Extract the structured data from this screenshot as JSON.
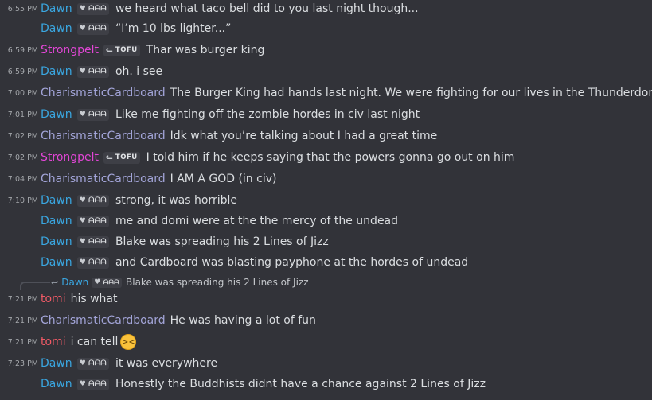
{
  "colors": {
    "dawn": "#3aa6e0",
    "strongpelt": "#e246d6",
    "cardboard": "#a3a5d9",
    "tomi": "#f05a66"
  },
  "tags": {
    "dawn": "ᗩᗩᗩ",
    "strongpelt": "TOFU"
  },
  "messages": [
    {
      "time": "6:55 PM",
      "author": "Dawn",
      "tag": "ᗩᗩᗩ",
      "text": "we heard what taco bell did to you last night though..."
    },
    {
      "time": "",
      "author": "Dawn",
      "tag": "ᗩᗩᗩ",
      "text": "“I’m 10 lbs lighter...”"
    },
    {
      "time": "6:59 PM",
      "author": "Strongpelt",
      "tag": "TOFU",
      "text": "Thar was burger king"
    },
    {
      "time": "6:59 PM",
      "author": "Dawn",
      "tag": "ᗩᗩᗩ",
      "text": "oh. i see"
    },
    {
      "time": "7:00 PM",
      "author": "CharismaticCardboard",
      "tag": "",
      "text": "The Burger King had hands last night. We were fighting for our lives in the Thunderdome"
    },
    {
      "time": "7:01 PM",
      "author": "Dawn",
      "tag": "ᗩᗩᗩ",
      "text": "Like me fighting off the zombie hordes in civ last night"
    },
    {
      "time": "7:02 PM",
      "author": "CharismaticCardboard",
      "tag": "",
      "text": "Idk what you’re talking about I had a great time"
    },
    {
      "time": "7:02 PM",
      "author": "Strongpelt",
      "tag": "TOFU",
      "text": "I told him if he keeps saying that the powers gonna go out on him"
    },
    {
      "time": "7:04 PM",
      "author": "CharismaticCardboard",
      "tag": "",
      "text": "I AM A GOD (in civ)"
    },
    {
      "time": "7:10 PM",
      "author": "Dawn",
      "tag": "ᗩᗩᗩ",
      "text": "strong, it was horrible"
    },
    {
      "time": "",
      "author": "Dawn",
      "tag": "ᗩᗩᗩ",
      "text": "me and domi were at the the mercy of the undead"
    },
    {
      "time": "",
      "author": "Dawn",
      "tag": "ᗩᗩᗩ",
      "text": "Blake was spreading his 2 Lines of Jizz"
    },
    {
      "time": "",
      "author": "Dawn",
      "tag": "ᗩᗩᗩ",
      "text": "and Cardboard was blasting payphone at the hordes of undead"
    },
    {
      "time": "7:21 PM",
      "author": "tomi",
      "tag": "",
      "text": "his what"
    },
    {
      "time": "7:21 PM",
      "author": "CharismaticCardboard",
      "tag": "",
      "text": "He was having a lot of fun"
    },
    {
      "time": "7:21 PM",
      "author": "tomi",
      "tag": "",
      "text": "i can tell"
    },
    {
      "time": "7:23 PM",
      "author": "Dawn",
      "tag": "ᗩᗩᗩ",
      "text": "it was everywhere"
    },
    {
      "time": "",
      "author": "Dawn",
      "tag": "ᗩᗩᗩ",
      "text": "Honestly the Buddhists didnt have a chance against 2 Lines of Jizz"
    }
  ],
  "reply": {
    "author": "Dawn",
    "tag": "ᗩᗩᗩ",
    "text": "Blake was spreading his 2 Lines of Jizz"
  },
  "emoji": {
    "name": "grinning-squinting-face-emoji",
    "glyph": "><"
  }
}
